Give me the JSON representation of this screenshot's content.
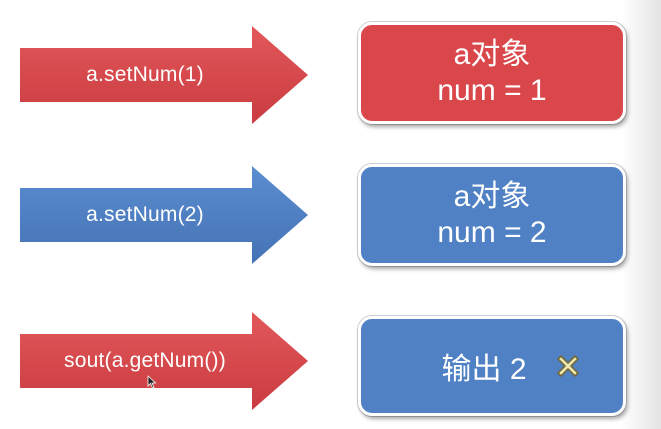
{
  "colors": {
    "red": "#d9474b",
    "blue": "#4f81c4"
  },
  "rows": [
    {
      "arrow_label": "a.setNum(1)",
      "box_lines": [
        "a对象",
        "num = 1"
      ]
    },
    {
      "arrow_label": "a.setNum(2)",
      "box_lines": [
        "a对象",
        "num = 2"
      ]
    },
    {
      "arrow_label": "sout(a.getNum())",
      "box_text": "输出 2",
      "box_icon": "cross-icon"
    }
  ]
}
